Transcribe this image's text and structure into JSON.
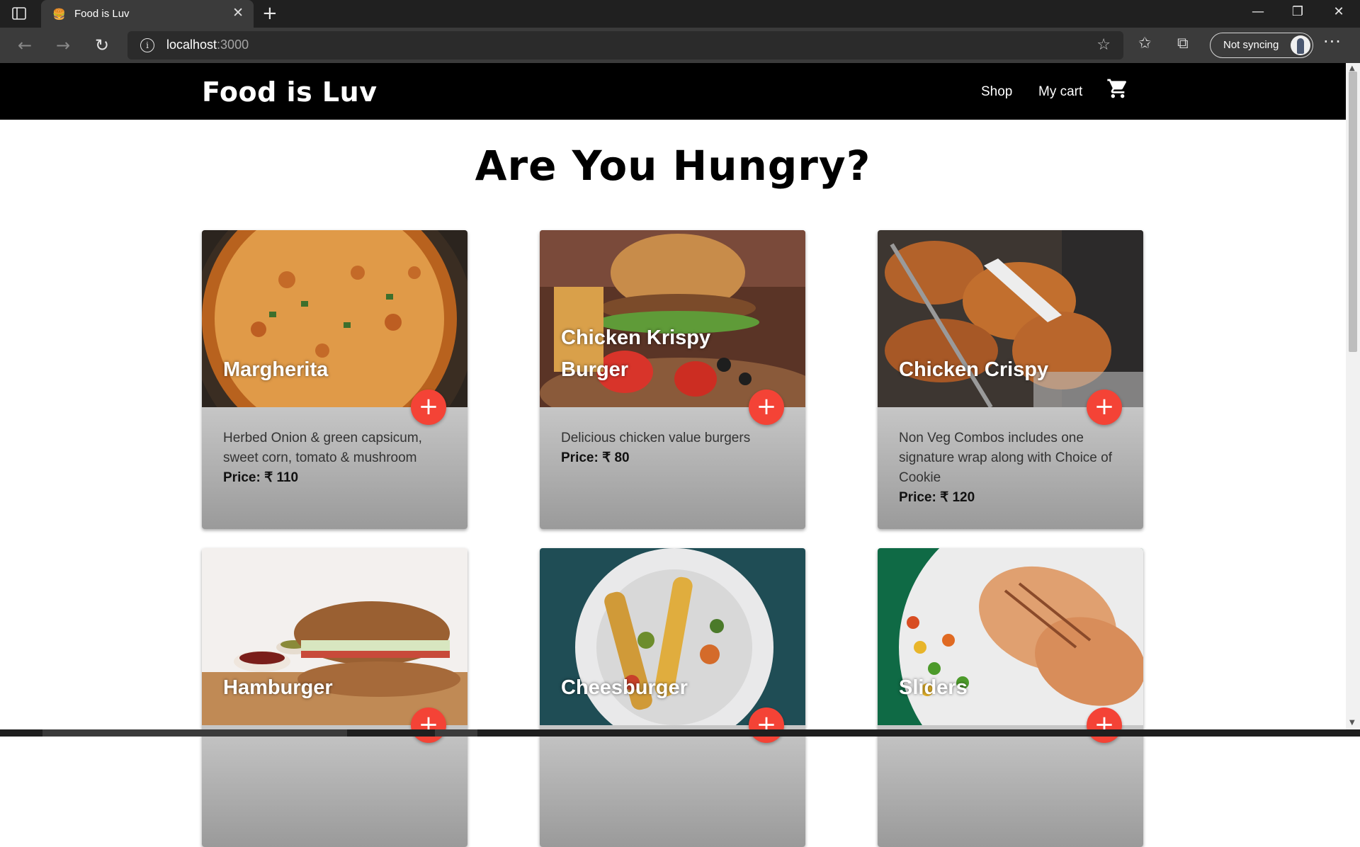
{
  "browser": {
    "tab_title": "Food is Luv",
    "url_host": "localhost",
    "url_port": ":3000",
    "sync_label": "Not syncing"
  },
  "site": {
    "brand": "Food is Luv",
    "nav": {
      "shop": "Shop",
      "my_cart": "My cart"
    },
    "heading": "Are You Hungry?"
  },
  "menu_items": [
    {
      "name": "Margherita",
      "description": "Herbed Onion & green capsicum, sweet corn, tomato & mushroom",
      "price": "Price: ₹ 110"
    },
    {
      "name": "Chicken Krispy Burger",
      "description": "Delicious chicken value burgers",
      "price": "Price: ₹ 80"
    },
    {
      "name": "Chicken Crispy",
      "description": "Non Veg Combos includes one signature wrap along with Choice of Cookie",
      "price": "Price: ₹ 120"
    },
    {
      "name": "Hamburger",
      "description": "",
      "price": ""
    },
    {
      "name": "Cheesburger",
      "description": "",
      "price": ""
    },
    {
      "name": "Sliders",
      "description": "",
      "price": ""
    }
  ],
  "colors": {
    "accent": "#f44336",
    "nav_bg": "#000000",
    "chrome_bg": "#202020"
  },
  "icons": {
    "cart": "cart-icon",
    "add": "plus-icon"
  }
}
